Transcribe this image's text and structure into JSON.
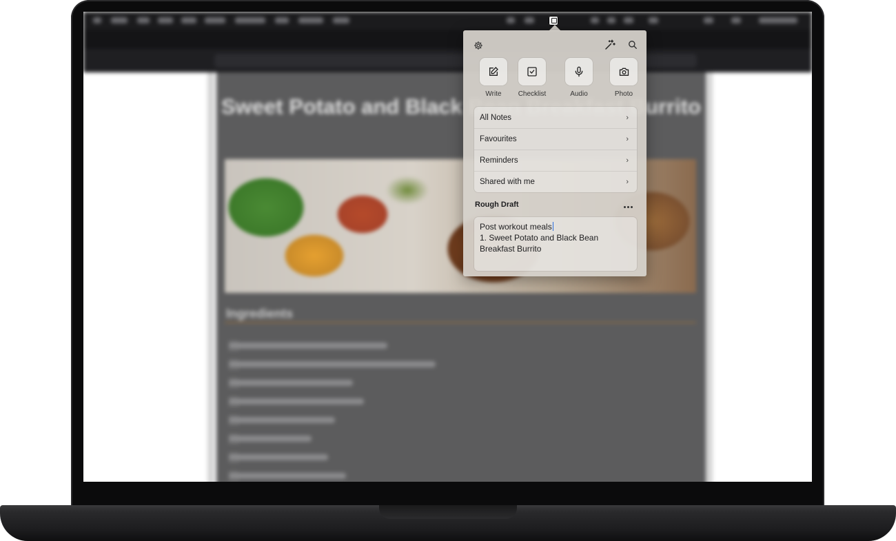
{
  "background": {
    "doc_title": "Sweet Potato and Black Bean Breakfast Burrito",
    "ingredients_heading": "Ingredients"
  },
  "panel": {
    "actions": [
      {
        "label": "Write",
        "icon": "pencil-square-icon"
      },
      {
        "label": "Checklist",
        "icon": "checkbox-icon"
      },
      {
        "label": "Audio",
        "icon": "microphone-icon"
      },
      {
        "label": "Photo",
        "icon": "camera-icon"
      }
    ],
    "nav": [
      {
        "label": "All Notes"
      },
      {
        "label": "Favourites"
      },
      {
        "label": "Reminders"
      },
      {
        "label": "Shared with me"
      }
    ],
    "draft": {
      "title": "Rough Draft",
      "lines": [
        "Post workout meals",
        "1. Sweet Potato and Black Bean",
        "Breakfast Burrito"
      ]
    },
    "chevron": "›"
  },
  "colors": {
    "panel_bg": "#d6d1cb",
    "caret": "#2a6ee0",
    "laptop_frame": "#0b0b0c"
  }
}
